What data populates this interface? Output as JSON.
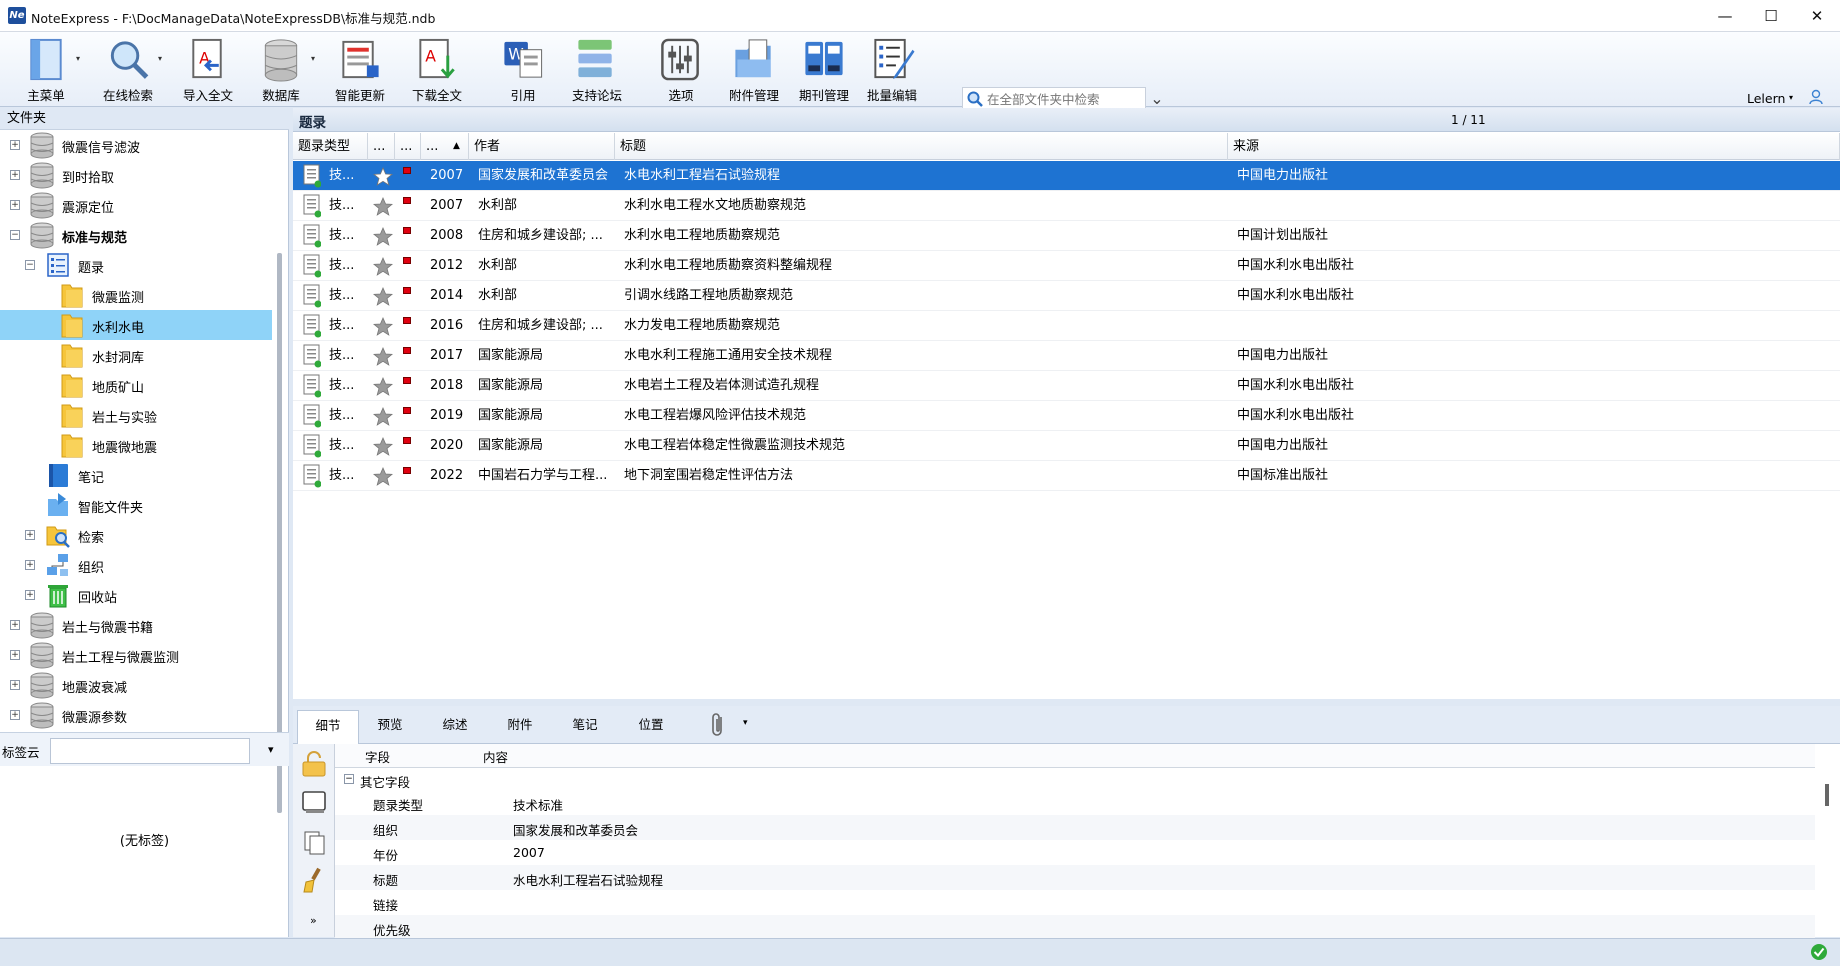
{
  "window": {
    "app_name": "NoteExpress",
    "logo_text": "Ne",
    "title": "NoteExpress - F:\\DocManageData\\NoteExpressDB\\标准与规范.ndb",
    "minimize": "—",
    "maximize": "☐",
    "close": "✕"
  },
  "toolbar": {
    "buttons": [
      {
        "label": "主菜单",
        "icon": "main-menu-icon"
      },
      {
        "label": "在线检索",
        "icon": "online-search-icon"
      },
      {
        "label": "导入全文",
        "icon": "import-fulltext-icon"
      },
      {
        "label": "数据库",
        "icon": "database-icon"
      },
      {
        "label": "智能更新",
        "icon": "smart-update-icon"
      },
      {
        "label": "下载全文",
        "icon": "download-fulltext-icon"
      },
      {
        "label": "引用",
        "icon": "cite-icon"
      },
      {
        "label": "支持论坛",
        "icon": "forum-icon"
      },
      {
        "label": "选项",
        "icon": "options-icon"
      },
      {
        "label": "附件管理",
        "icon": "attachment-manage-icon"
      },
      {
        "label": "期刊管理",
        "icon": "journal-manage-icon"
      },
      {
        "label": "批量编辑",
        "icon": "batch-edit-icon"
      }
    ],
    "search_placeholder": "在全部文件夹中检索",
    "dropdown": "⌄",
    "user": "Lelern",
    "user_dd": "▾"
  },
  "folders": {
    "header": "文件夹",
    "items": [
      {
        "label": "微震信号滤波",
        "level": 0,
        "icon": "database",
        "expander": "+"
      },
      {
        "label": "到时拾取",
        "level": 0,
        "icon": "database",
        "expander": "+"
      },
      {
        "label": "震源定位",
        "level": 0,
        "icon": "database",
        "expander": "+"
      },
      {
        "label": "标准与规范",
        "level": 0,
        "icon": "database",
        "expander": "−",
        "bold": true
      },
      {
        "label": "题录",
        "level": 1,
        "icon": "list",
        "expander": "−"
      },
      {
        "label": "微震监测",
        "level": 2,
        "icon": "folder",
        "expander": ""
      },
      {
        "label": "水利水电",
        "level": 2,
        "icon": "folder",
        "expander": "",
        "selected": true
      },
      {
        "label": "水封洞库",
        "level": 2,
        "icon": "folder",
        "expander": ""
      },
      {
        "label": "地质矿山",
        "level": 2,
        "icon": "folder",
        "expander": ""
      },
      {
        "label": "岩土与实验",
        "level": 2,
        "icon": "folder",
        "expander": ""
      },
      {
        "label": "地震微地震",
        "level": 2,
        "icon": "folder",
        "expander": ""
      },
      {
        "label": "笔记",
        "level": 1,
        "icon": "notebook",
        "expander": ""
      },
      {
        "label": "智能文件夹",
        "level": 1,
        "icon": "smart-folder",
        "expander": ""
      },
      {
        "label": "检索",
        "level": 1,
        "icon": "search-folder",
        "expander": "+"
      },
      {
        "label": "组织",
        "level": 1,
        "icon": "organize",
        "expander": "+"
      },
      {
        "label": "回收站",
        "level": 1,
        "icon": "recycle",
        "expander": "+"
      },
      {
        "label": "岩土与微震书籍",
        "level": 0,
        "icon": "database",
        "expander": "+"
      },
      {
        "label": "岩土工程与微震监测",
        "level": 0,
        "icon": "database",
        "expander": "+"
      },
      {
        "label": "地震波衰减",
        "level": 0,
        "icon": "database",
        "expander": "+"
      },
      {
        "label": "微震源参数",
        "level": 0,
        "icon": "database",
        "expander": "+"
      }
    ]
  },
  "tagcloud": {
    "label": "标签云",
    "dd": "▾",
    "empty": "(无标签)"
  },
  "list": {
    "title": "题录",
    "page": "1 / 11",
    "columns": [
      "题录类型",
      "...",
      "...",
      "...",
      "作者",
      "标题",
      "来源"
    ],
    "sort_indicator": "▲",
    "rows": [
      {
        "type": "技...",
        "year": "2007",
        "author": "国家发展和改革委员会",
        "title": "水电水利工程岩石试验规程",
        "source": "中国电力出版社",
        "selected": true
      },
      {
        "type": "技...",
        "year": "2007",
        "author": "水利部",
        "title": "水利水电工程水文地质勘察规范",
        "source": ""
      },
      {
        "type": "技...",
        "year": "2008",
        "author": "住房和城乡建设部; ...",
        "title": "水利水电工程地质勘察规范",
        "source": "中国计划出版社"
      },
      {
        "type": "技...",
        "year": "2012",
        "author": "水利部",
        "title": "水利水电工程地质勘察资料整编规程",
        "source": "中国水利水电出版社"
      },
      {
        "type": "技...",
        "year": "2014",
        "author": "水利部",
        "title": "引调水线路工程地质勘察规范",
        "source": "中国水利水电出版社"
      },
      {
        "type": "技...",
        "year": "2016",
        "author": "住房和城乡建设部; ...",
        "title": "水力发电工程地质勘察规范",
        "source": ""
      },
      {
        "type": "技...",
        "year": "2017",
        "author": "国家能源局",
        "title": "水电水利工程施工通用安全技术规程",
        "source": "中国电力出版社"
      },
      {
        "type": "技...",
        "year": "2018",
        "author": "国家能源局",
        "title": "水电岩土工程及岩体测试造孔规程",
        "source": "中国水利水电出版社"
      },
      {
        "type": "技...",
        "year": "2019",
        "author": "国家能源局",
        "title": "水电工程岩爆风险评估技术规范",
        "source": "中国水利水电出版社"
      },
      {
        "type": "技...",
        "year": "2020",
        "author": "国家能源局",
        "title": "水电工程岩体稳定性微震监测技术规范",
        "source": "中国电力出版社"
      },
      {
        "type": "技...",
        "year": "2022",
        "author": "中国岩石力学与工程...",
        "title": "地下洞室围岩稳定性评估方法",
        "source": "中国标准出版社"
      }
    ]
  },
  "detail": {
    "tabs": [
      "细节",
      "预览",
      "综述",
      "附件",
      "笔记",
      "位置"
    ],
    "attach_dd": "▾",
    "head": {
      "field": "字段",
      "content": "内容"
    },
    "group": "其它字段",
    "group_toggle": "−",
    "more": "»",
    "fields": [
      {
        "k": "题录类型",
        "v": "技术标准"
      },
      {
        "k": "组织",
        "v": "国家发展和改革委员会"
      },
      {
        "k": "年份",
        "v": "2007"
      },
      {
        "k": "标题",
        "v": "水电水利工程岩石试验规程"
      },
      {
        "k": "链接",
        "v": ""
      },
      {
        "k": "优先级",
        "v": ""
      }
    ]
  },
  "colors": {
    "selection": "#1e73d2",
    "tree_selection": "#8fd3f8",
    "folder": "#f6c53b",
    "flag": "#e00010"
  }
}
